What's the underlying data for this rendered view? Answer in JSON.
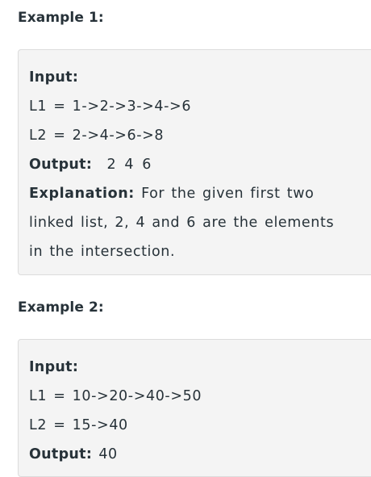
{
  "example1": {
    "heading": "Example 1:",
    "input_label": "Input:",
    "l1": "L1 = 1->2->3->4->6",
    "l2": "L2 = 2->4->6->8",
    "output_label": "Output:",
    "output_value": "2 4 6",
    "explanation_label": "Explanation:",
    "explanation_text": "For the given first two linked list, 2, 4 and 6 are the elements in the intersection."
  },
  "example2": {
    "heading": "Example 2:",
    "input_label": "Input:",
    "l1": "L1 = 10->20->40->50",
    "l2": "L2 = 15->40",
    "output_label": "Output:",
    "output_value": "40"
  }
}
